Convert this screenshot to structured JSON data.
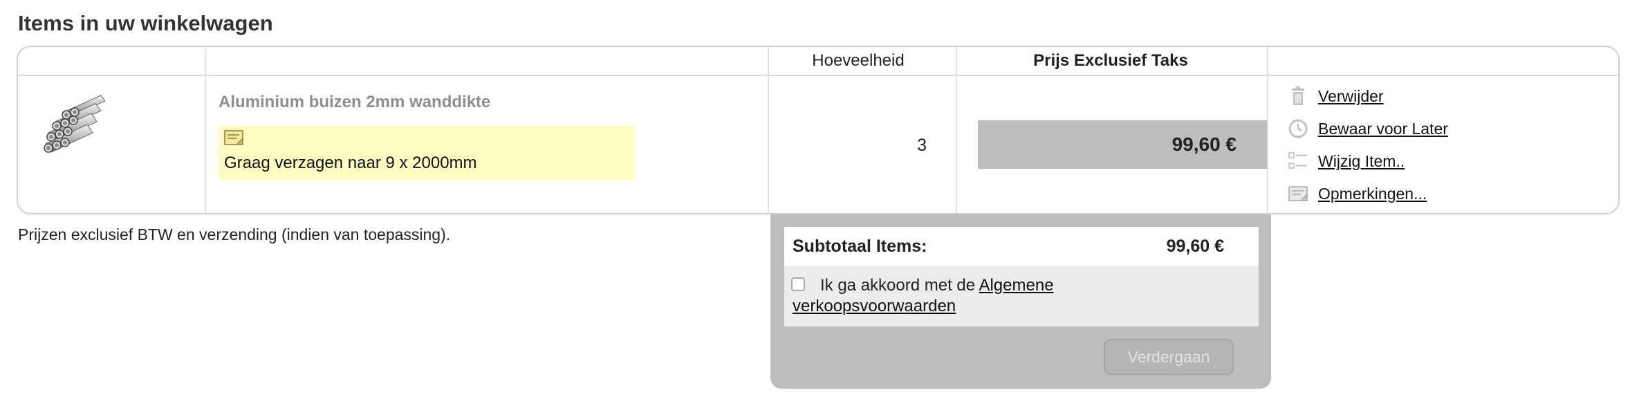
{
  "page_title": "Items in uw winkelwagen",
  "table": {
    "columns": {
      "quantity": "Hoeveelheid",
      "price": "Prijs Exclusief Taks"
    },
    "item": {
      "image_icon": "aluminium-tubes-icon",
      "name": "Aluminium buizen 2mm wanddikte",
      "note_icon": "note-icon",
      "note": "Graag verzagen naar 9 x 2000mm",
      "quantity": "3",
      "price": "99,60 €",
      "actions": [
        {
          "icon": "trash-icon",
          "label": "Verwijder"
        },
        {
          "icon": "clock-icon",
          "label": "Bewaar voor Later"
        },
        {
          "icon": "list-edit-icon",
          "label": "Wijzig Item.."
        },
        {
          "icon": "note-icon",
          "label": "Opmerkingen..."
        }
      ]
    }
  },
  "disclaimer": "Prijzen exclusief BTW en verzending (indien van toepassing).",
  "summary": {
    "subtotal_label": "Subtotaal Items:",
    "subtotal_value": "99,60 €",
    "agree_prefix": "Ik ga akkoord met de",
    "agree_link": "Algemene verkoopsvoorwaarden",
    "agree_checked": false,
    "continue_label": "Verdergaan",
    "continue_enabled": false
  },
  "colors": {
    "note_background": "#fdfcc3",
    "price_background": "#bdbdbd",
    "product_name": "#8e8e8e"
  }
}
